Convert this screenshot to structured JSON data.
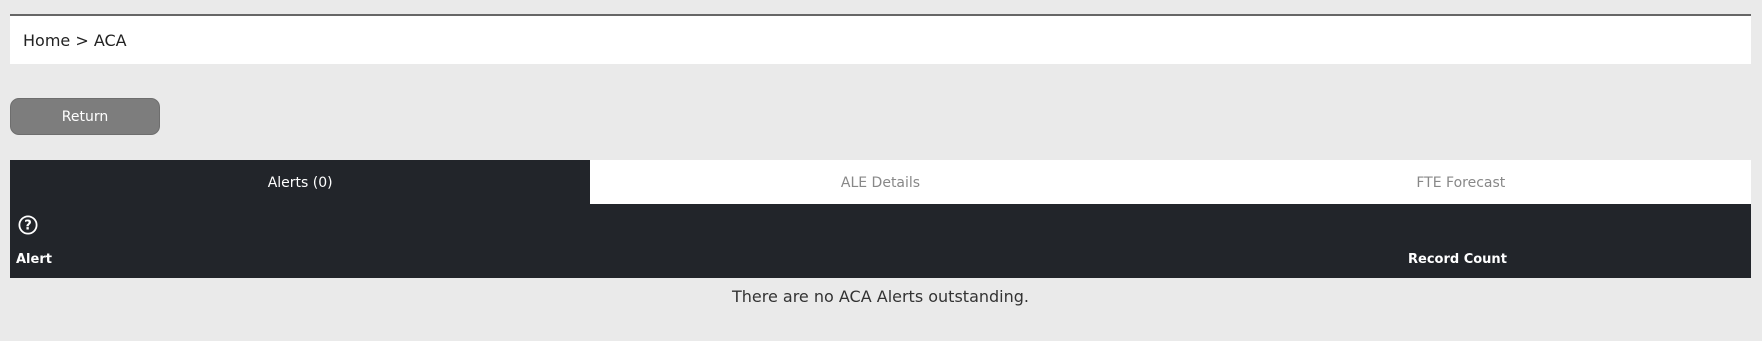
{
  "breadcrumb": {
    "home": "Home",
    "separator": " > ",
    "current": "ACA"
  },
  "return_button": {
    "label": "Return"
  },
  "tabs": [
    {
      "label": "Alerts (0)",
      "active": true
    },
    {
      "label": "ALE Details",
      "active": false
    },
    {
      "label": "FTE Forecast",
      "active": false
    }
  ],
  "table": {
    "help_icon": "help-icon",
    "columns": [
      "Alert",
      "Record Count"
    ],
    "empty_message": "There are no ACA Alerts outstanding."
  },
  "colors": {
    "background": "#eaeaea",
    "active_tab": "#22252a",
    "button": "#7d7d7d"
  }
}
